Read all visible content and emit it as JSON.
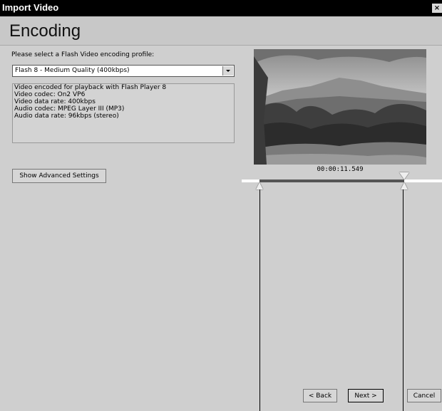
{
  "window": {
    "title": "Import Video",
    "close_glyph": "×"
  },
  "page": {
    "heading": "Encoding"
  },
  "encoding": {
    "prompt": "Please select a Flash Video encoding profile:",
    "selected_profile": "Flash 8 - Medium Quality (400kbps)",
    "description": [
      "Video encoded for playback with Flash Player 8",
      "Video codec: On2 VP6",
      "Video data rate: 400kbps",
      "Audio codec: MPEG Layer III (MP3)",
      "Audio data rate: 96kbps (stereo)"
    ],
    "advanced_button": "Show Advanced Settings"
  },
  "preview": {
    "timecode": "00:00:11.549",
    "playhead_fraction": 0.81,
    "in_point_fraction": 0.09,
    "out_point_fraction": 0.81
  },
  "nav": {
    "back": "< Back",
    "next": "Next >",
    "cancel": "Cancel"
  }
}
